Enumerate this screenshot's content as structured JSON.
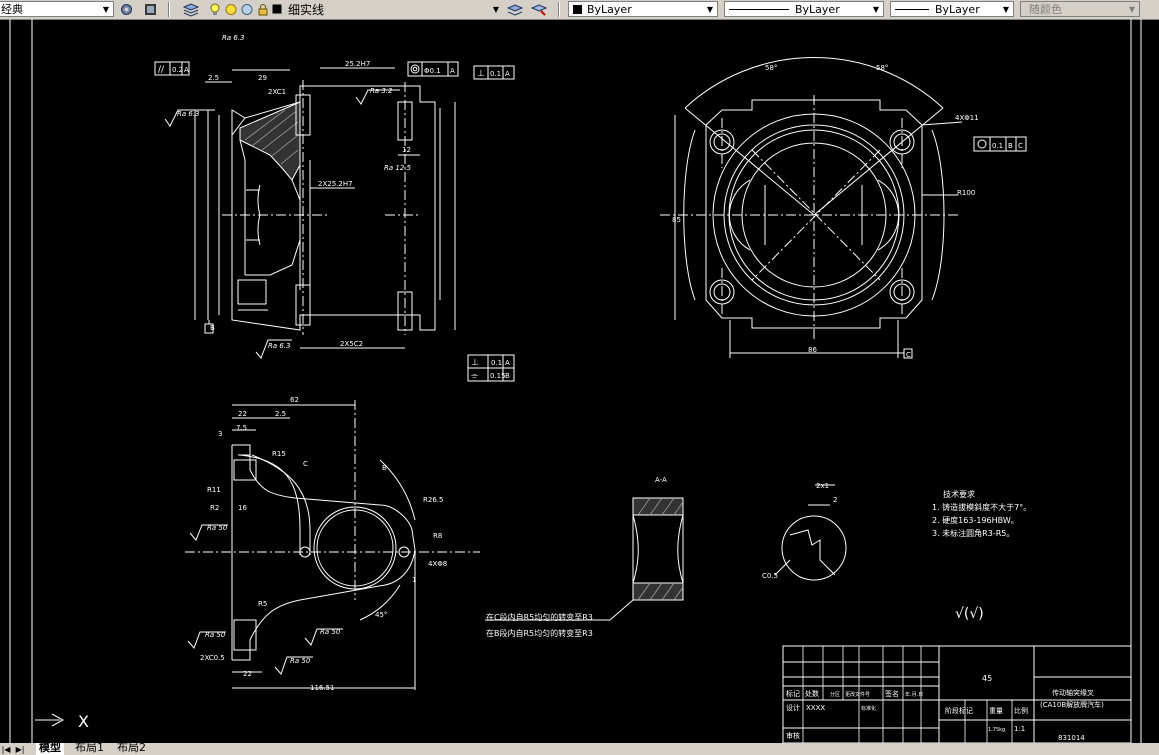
{
  "toolbar": {
    "workspace": "经典",
    "layer": "细实线",
    "color": "ByLayer",
    "linetype": "ByLayer",
    "lineweight": "ByLayer",
    "plotstyle": "随颜色"
  },
  "tabs": [
    "模型",
    "布局1",
    "布局2"
  ],
  "drawing": {
    "ra_63": "Ra 6.3",
    "ra_125": "Ra 12.5",
    "ra_50": "Ra 50",
    "ra_32": "Ra 3.2",
    "frame_line": "0.2",
    "frame_line_ref": "A",
    "frame_perp": "0.1",
    "frame_circ": "Φ0.1",
    "frame_pos": "0.1",
    "frame_pos_b": "B",
    "frame_pos_c": "C",
    "frame_flat2": "0.15",
    "datum_a": "A",
    "datum_b": "B",
    "datum_c": "C",
    "dim_29": "29",
    "dim_25": "2.5",
    "dim_2xc1": "2XC1",
    "dim_25hd": "25.2H7",
    "dim_25_2": "2X25.2H7",
    "dim_2x18": "2X18",
    "dim_2x5": "2X5",
    "dim_2x5c2": "2X5C2",
    "dim_r100": "R100",
    "dim_4xd11": "4XΦ11",
    "dim_85": "85",
    "dim_86": "86",
    "dim_86b": "86",
    "dim_58": "58°",
    "dim_62": "62",
    "dim_22": "22",
    "dim_r15": "R15",
    "dim_r11": "R11",
    "dim_r5": "R5",
    "dim_r2": "R2",
    "dim_r30": "R30",
    "dim_r265": "R26.5",
    "dim_r8": "R8",
    "dim_4xd8": "4XΦ8",
    "dim_45": "45°",
    "dim_116": "116.51",
    "dim_c05": "C0.5",
    "dim_2xc05": "2XC0.5",
    "dim_c": "C",
    "dim_b": "B",
    "dim_1": "1",
    "dim_2": "2",
    "dim_2x1": "2x1",
    "dim_12": "12",
    "dim_7": "7",
    "dim_16": "16",
    "dim_3": "3",
    "dim_75": "7.5",
    "section_aa": "A-A",
    "note_c": "在C段内自R5均匀的转变至R3",
    "note_b": "在B段内自R5均匀的转变至R3",
    "tech_title": "技术要求",
    "tech_1": "1. 铸造拔模斜度不大于7°。",
    "tech_2": "2. 硬度163-196HBW。",
    "tech_3": "3. 未标注圆角R3-R5。",
    "rough_general": "√(√)"
  },
  "titleblock": {
    "material": "45",
    "part_name_1": "传动轴突缘叉",
    "part_name_2": "(CA10B解放牌汽车)",
    "drawing_no": "831014",
    "scale_label": "比例",
    "scale_value": "1:1",
    "weight_label": "重量",
    "weight_value": "1.75kg",
    "stage_label": "阶段标记",
    "design_label": "设计",
    "designer": "XXXX",
    "standard_label": "标准化",
    "review_label": "审核",
    "col_mark": "标记",
    "col_count": "处数",
    "col_zone": "分区",
    "col_doc": "更改文件号",
    "col_sign": "签名",
    "col_date": "年.月.日"
  }
}
